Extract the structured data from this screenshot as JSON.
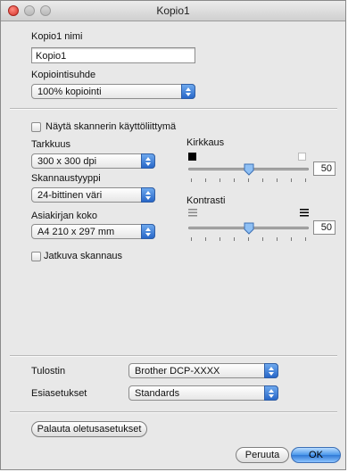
{
  "window": {
    "title": "Kopio1"
  },
  "name_section": {
    "name_label": "Kopio1 nimi",
    "name_value": "Kopio1",
    "ratio_label": "Kopiointisuhde",
    "ratio_value": "100% kopiointi"
  },
  "scanner": {
    "show_ui_label": "Näytä skannerin käyttöliittymä",
    "show_ui_checked": false,
    "resolution_label": "Tarkkuus",
    "resolution_value": "300 x 300 dpi",
    "scan_type_label": "Skannaustyyppi",
    "scan_type_value": "24-bittinen väri",
    "doc_size_label": "Asiakirjan koko",
    "doc_size_value": "A4 210 x 297 mm",
    "continuous_label": "Jatkuva skannaus",
    "continuous_checked": false,
    "brightness_label": "Kirkkaus",
    "brightness_value": "50",
    "contrast_label": "Kontrasti",
    "contrast_value": "50"
  },
  "printer": {
    "printer_label": "Tulostin",
    "printer_value": "Brother DCP-XXXX",
    "presets_label": "Esiasetukset",
    "presets_value": "Standards"
  },
  "buttons": {
    "restore_defaults": "Palauta oletusasetukset",
    "cancel": "Peruuta",
    "ok": "OK"
  }
}
